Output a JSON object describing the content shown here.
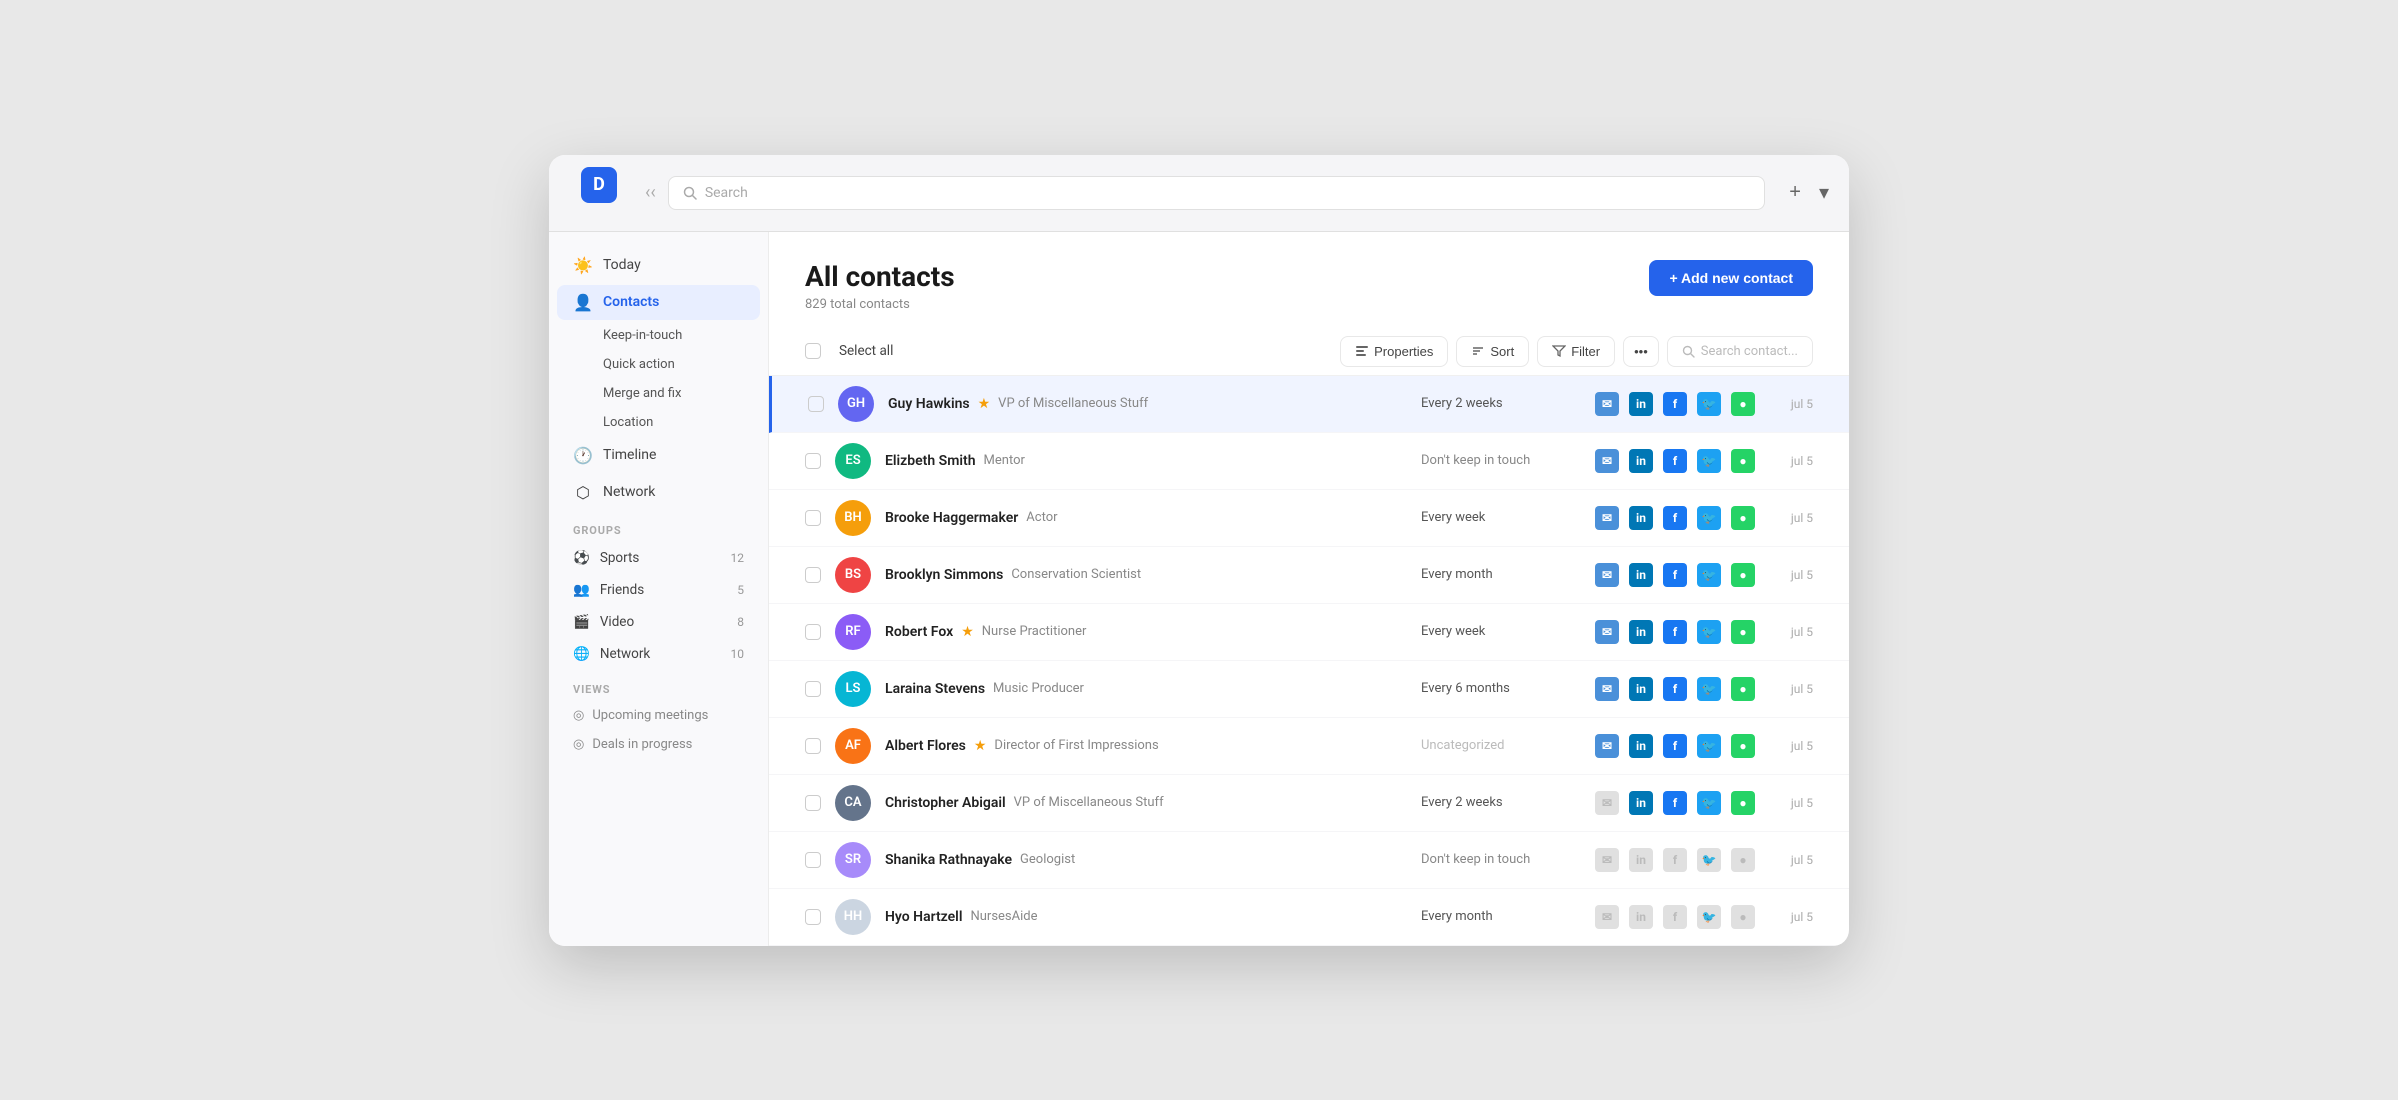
{
  "app": {
    "logo_letter": "D"
  },
  "titlebar": {
    "search_placeholder": "Search",
    "plus_label": "+",
    "chevron_label": "▾"
  },
  "sidebar": {
    "nav_items": [
      {
        "id": "today",
        "icon": "☀",
        "label": "Today",
        "active": false
      },
      {
        "id": "contacts",
        "icon": "👤",
        "label": "Contacts",
        "active": true
      }
    ],
    "sub_items": [
      {
        "id": "keep-in-touch",
        "label": "Keep-in-touch"
      },
      {
        "id": "quick-action",
        "label": "Quick action"
      },
      {
        "id": "merge-and-fix",
        "label": "Merge and fix"
      },
      {
        "id": "location",
        "label": "Location"
      }
    ],
    "secondary_nav": [
      {
        "id": "timeline",
        "icon": "🕐",
        "label": "Timeline"
      },
      {
        "id": "network",
        "icon": "⬡",
        "label": "Network"
      }
    ],
    "groups_label": "GROUPS",
    "groups": [
      {
        "id": "sports",
        "label": "Sports",
        "count": "12",
        "color": "#f59e0b",
        "emoji": "⚽"
      },
      {
        "id": "friends",
        "label": "Friends",
        "count": "5",
        "color": "#ef4444",
        "emoji": "👥"
      },
      {
        "id": "video",
        "label": "Video",
        "count": "8",
        "color": "#8b5cf6",
        "emoji": "🎬"
      },
      {
        "id": "network",
        "label": "Network",
        "count": "10",
        "color": "#3b82f6",
        "emoji": "🌐"
      }
    ],
    "views_label": "VIEWS",
    "views": [
      {
        "id": "upcoming-meetings",
        "label": "Upcoming meetings",
        "icon": "◎"
      },
      {
        "id": "deals-in-progress",
        "label": "Deals in progress",
        "icon": "◎"
      }
    ]
  },
  "header": {
    "title": "All contacts",
    "subtitle": "829 total contacts",
    "add_btn_label": "+ Add new contact"
  },
  "toolbar": {
    "select_all": "Select all",
    "properties_label": "Properties",
    "sort_label": "Sort",
    "filter_label": "Filter",
    "more_label": "•••",
    "search_placeholder": "Search contact..."
  },
  "contacts": [
    {
      "id": 1,
      "name": "Guy Hawkins",
      "star": true,
      "role": "VP of Miscellaneous Stuff",
      "frequency": "Every 2 weeks",
      "freq_class": "normal",
      "date": "jul 5",
      "avatar_color": "#6366f1",
      "avatar_initials": "GH",
      "highlighted": true,
      "social": [
        "email",
        "linkedin",
        "facebook",
        "twitter",
        "whatsapp"
      ]
    },
    {
      "id": 2,
      "name": "Elizbeth Smith",
      "star": false,
      "role": "Mentor",
      "frequency": "Don't keep in touch",
      "freq_class": "dont-keep",
      "date": "jul 5",
      "avatar_color": "#10b981",
      "avatar_initials": "ES",
      "highlighted": false,
      "social": [
        "email",
        "linkedin",
        "facebook",
        "twitter",
        "whatsapp"
      ]
    },
    {
      "id": 3,
      "name": "Brooke Haggermaker",
      "star": false,
      "role": "Actor",
      "frequency": "Every week",
      "freq_class": "normal",
      "date": "jul 5",
      "avatar_color": "#f59e0b",
      "avatar_initials": "BH",
      "highlighted": false,
      "social": [
        "email",
        "linkedin",
        "facebook",
        "twitter",
        "whatsapp"
      ]
    },
    {
      "id": 4,
      "name": "Brooklyn Simmons",
      "star": false,
      "role": "Conservation Scientist",
      "frequency": "Every month",
      "freq_class": "normal",
      "date": "jul 5",
      "avatar_color": "#ef4444",
      "avatar_initials": "BS",
      "highlighted": false,
      "social": [
        "email",
        "linkedin",
        "facebook",
        "twitter",
        "whatsapp"
      ]
    },
    {
      "id": 5,
      "name": "Robert Fox",
      "star": true,
      "role": "Nurse Practitioner",
      "frequency": "Every week",
      "freq_class": "normal",
      "date": "jul 5",
      "avatar_color": "#8b5cf6",
      "avatar_initials": "RF",
      "highlighted": false,
      "social": [
        "email",
        "linkedin",
        "facebook",
        "twitter",
        "whatsapp"
      ]
    },
    {
      "id": 6,
      "name": "Laraina Stevens",
      "star": false,
      "role": "Music Producer",
      "frequency": "Every 6 months",
      "freq_class": "normal",
      "date": "jul 5",
      "avatar_color": "#06b6d4",
      "avatar_initials": "LS",
      "highlighted": false,
      "social": [
        "email",
        "linkedin",
        "facebook",
        "twitter",
        "whatsapp"
      ]
    },
    {
      "id": 7,
      "name": "Albert Flores",
      "star": true,
      "role": "Director of First Impressions",
      "frequency": "Uncategorized",
      "freq_class": "uncategorized",
      "date": "jul 5",
      "avatar_color": "#f97316",
      "avatar_initials": "AF",
      "highlighted": false,
      "social": [
        "email",
        "linkedin",
        "facebook",
        "twitter",
        "whatsapp"
      ]
    },
    {
      "id": 8,
      "name": "Christopher Abigail",
      "star": false,
      "role": "VP of Miscellaneous Stuff",
      "frequency": "Every 2 weeks",
      "freq_class": "normal",
      "date": "jul 5",
      "avatar_color": "#64748b",
      "avatar_initials": "CA",
      "highlighted": false,
      "social": [
        "email-disabled",
        "linkedin",
        "facebook",
        "twitter",
        "whatsapp"
      ]
    },
    {
      "id": 9,
      "name": "Shanika Rathnayake",
      "star": false,
      "role": "Geologist",
      "frequency": "Don't keep in touch",
      "freq_class": "dont-keep",
      "date": "jul 5",
      "avatar_color": "#a78bfa",
      "avatar_initials": "SR",
      "highlighted": false,
      "social": [
        "email-disabled",
        "linkedin-disabled",
        "facebook-disabled",
        "twitter-disabled",
        "whatsapp-disabled"
      ]
    },
    {
      "id": 10,
      "name": "Hyo Hartzell",
      "star": false,
      "role": "NursesAide",
      "frequency": "Every month",
      "freq_class": "normal",
      "date": "jul 5",
      "avatar_color": "#cbd5e1",
      "avatar_initials": "HH",
      "highlighted": false,
      "social": [
        "email-disabled",
        "linkedin-disabled",
        "facebook-disabled",
        "twitter-disabled",
        "whatsapp-disabled"
      ]
    }
  ]
}
